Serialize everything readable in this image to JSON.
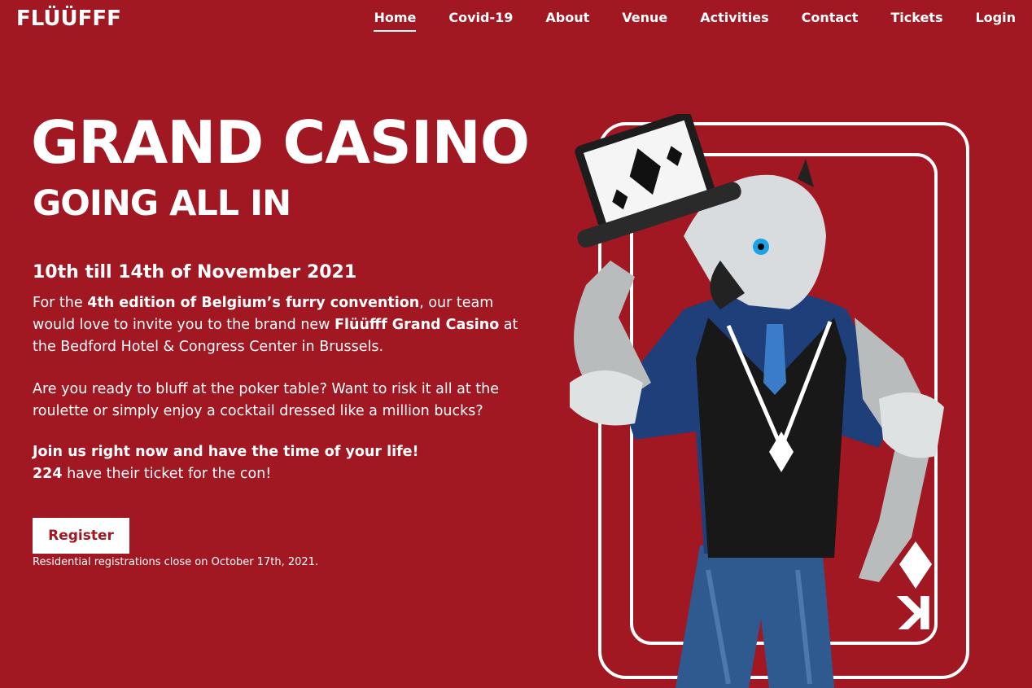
{
  "brand": {
    "logo_text": "FLÜÜFFF"
  },
  "nav": {
    "items": [
      {
        "label": "Home",
        "active": true
      },
      {
        "label": "Covid-19"
      },
      {
        "label": "About"
      },
      {
        "label": "Venue"
      },
      {
        "label": "Activities"
      },
      {
        "label": "Contact"
      },
      {
        "label": "Tickets"
      },
      {
        "label": "Login"
      }
    ]
  },
  "hero": {
    "title": "GRAND CASINO",
    "subtitle": "GOING ALL IN",
    "dates": "10th till 14th of November 2021",
    "p1_a": "For the ",
    "p1_b": "4th edition of Belgium’s furry convention",
    "p1_c": ", our team would love to invite you to the brand new ",
    "p1_d": "Flüüfff Grand Casino",
    "p1_e": " at the Bedford Hotel & Congress Center in Brussels.",
    "p2": "Are you ready to bluff at the poker table? Want to risk it all at the roulette or simply enjoy a cocktail dressed like a million bucks?",
    "p3_bold": "Join us right now and have the time of your life!",
    "ticket_count": "224",
    "ticket_text": " have their ticket for the con!",
    "register_label": "Register",
    "register_note": "Residential registrations close on October 17th, 2021."
  },
  "card": {
    "corner_rank": "K",
    "suit": "diamond"
  },
  "colors": {
    "background": "#a11722",
    "accent": "#ffffff"
  }
}
